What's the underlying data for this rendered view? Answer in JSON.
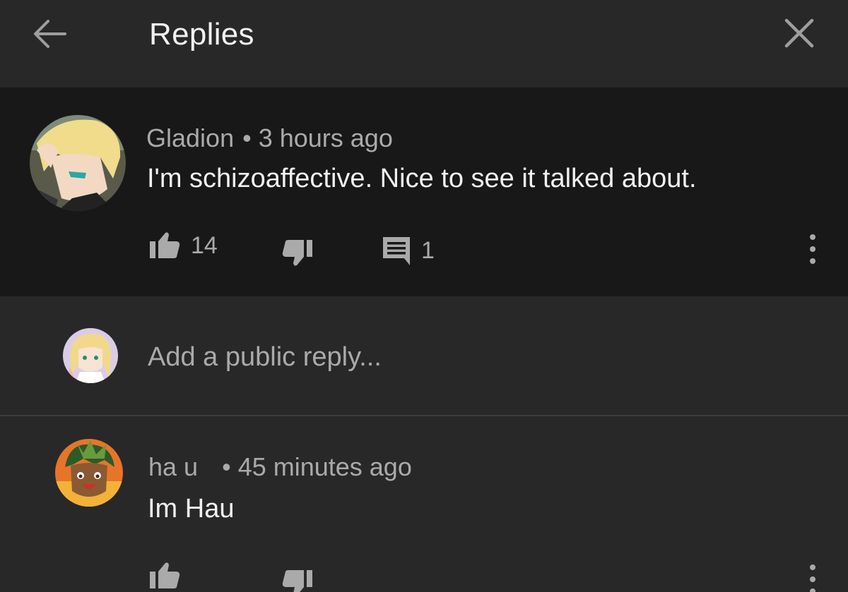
{
  "header": {
    "title": "Replies",
    "back_icon": "arrow-left-icon",
    "close_icon": "close-icon"
  },
  "parent_comment": {
    "author": "Gladion",
    "separator": "•",
    "time": "3 hours ago",
    "text": "I'm schizoaffective. Nice to see it talked about.",
    "likes": "14",
    "replies": "1",
    "icons": [
      "thumbs-up-icon",
      "thumbs-down-icon",
      "comment-icon",
      "more-vertical-icon"
    ]
  },
  "reply_box": {
    "placeholder": "Add a public reply..."
  },
  "replies": [
    {
      "author": "ha u",
      "separator": "•",
      "time": "45 minutes ago",
      "text": "Im Hau"
    }
  ],
  "colors": {
    "background": "#282828",
    "highlight": "#181818",
    "primary_text": "#f1f1f1",
    "secondary_text": "#aaaaaa"
  }
}
